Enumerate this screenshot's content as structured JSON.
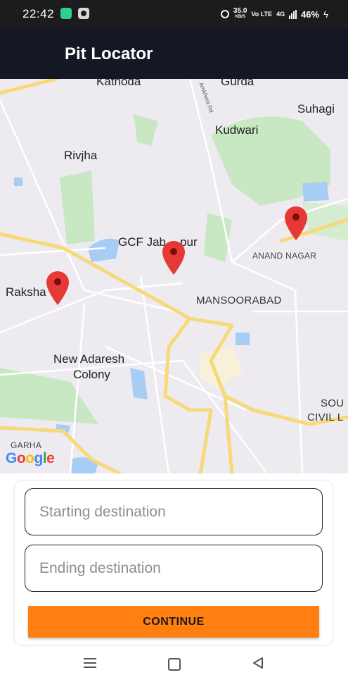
{
  "status_bar": {
    "time": "22:42",
    "net_speed": "35.0",
    "net_unit": "KB/S",
    "volte": "Vo LTE",
    "network": "4G",
    "battery": "46%"
  },
  "app_bar": {
    "title": "Pit Locator"
  },
  "map": {
    "labels": {
      "kathoda": "Kathoda",
      "gurda": "Gurda",
      "suhagi": "Suhagi",
      "kudwari": "Kudwari",
      "rivjha": "Rivjha",
      "gcf_1": "GCF Jab",
      "gcf_2": "pur",
      "anand_nagar": "ANAND NAGAR",
      "raksha": "Raksha",
      "mansoorabad": "MANSOORABAD",
      "new_adaresh_1": "New Adaresh",
      "new_adaresh_2": "Colony",
      "sou": "SOU",
      "civil": "CIVIL L",
      "garha": "GARHA",
      "amkhera_rd": "Amkhera Rd"
    },
    "google_logo": "Google",
    "pin_color": "#e53935",
    "water_color": "#a8cdf5",
    "park_color": "#c7e8c3",
    "road_color": "#f6d97a"
  },
  "form": {
    "start_placeholder": "Starting destination",
    "start_value": "",
    "end_placeholder": "Ending destination",
    "end_value": "",
    "continue_label": "CONTINUE",
    "accent": "#ff7f11"
  }
}
